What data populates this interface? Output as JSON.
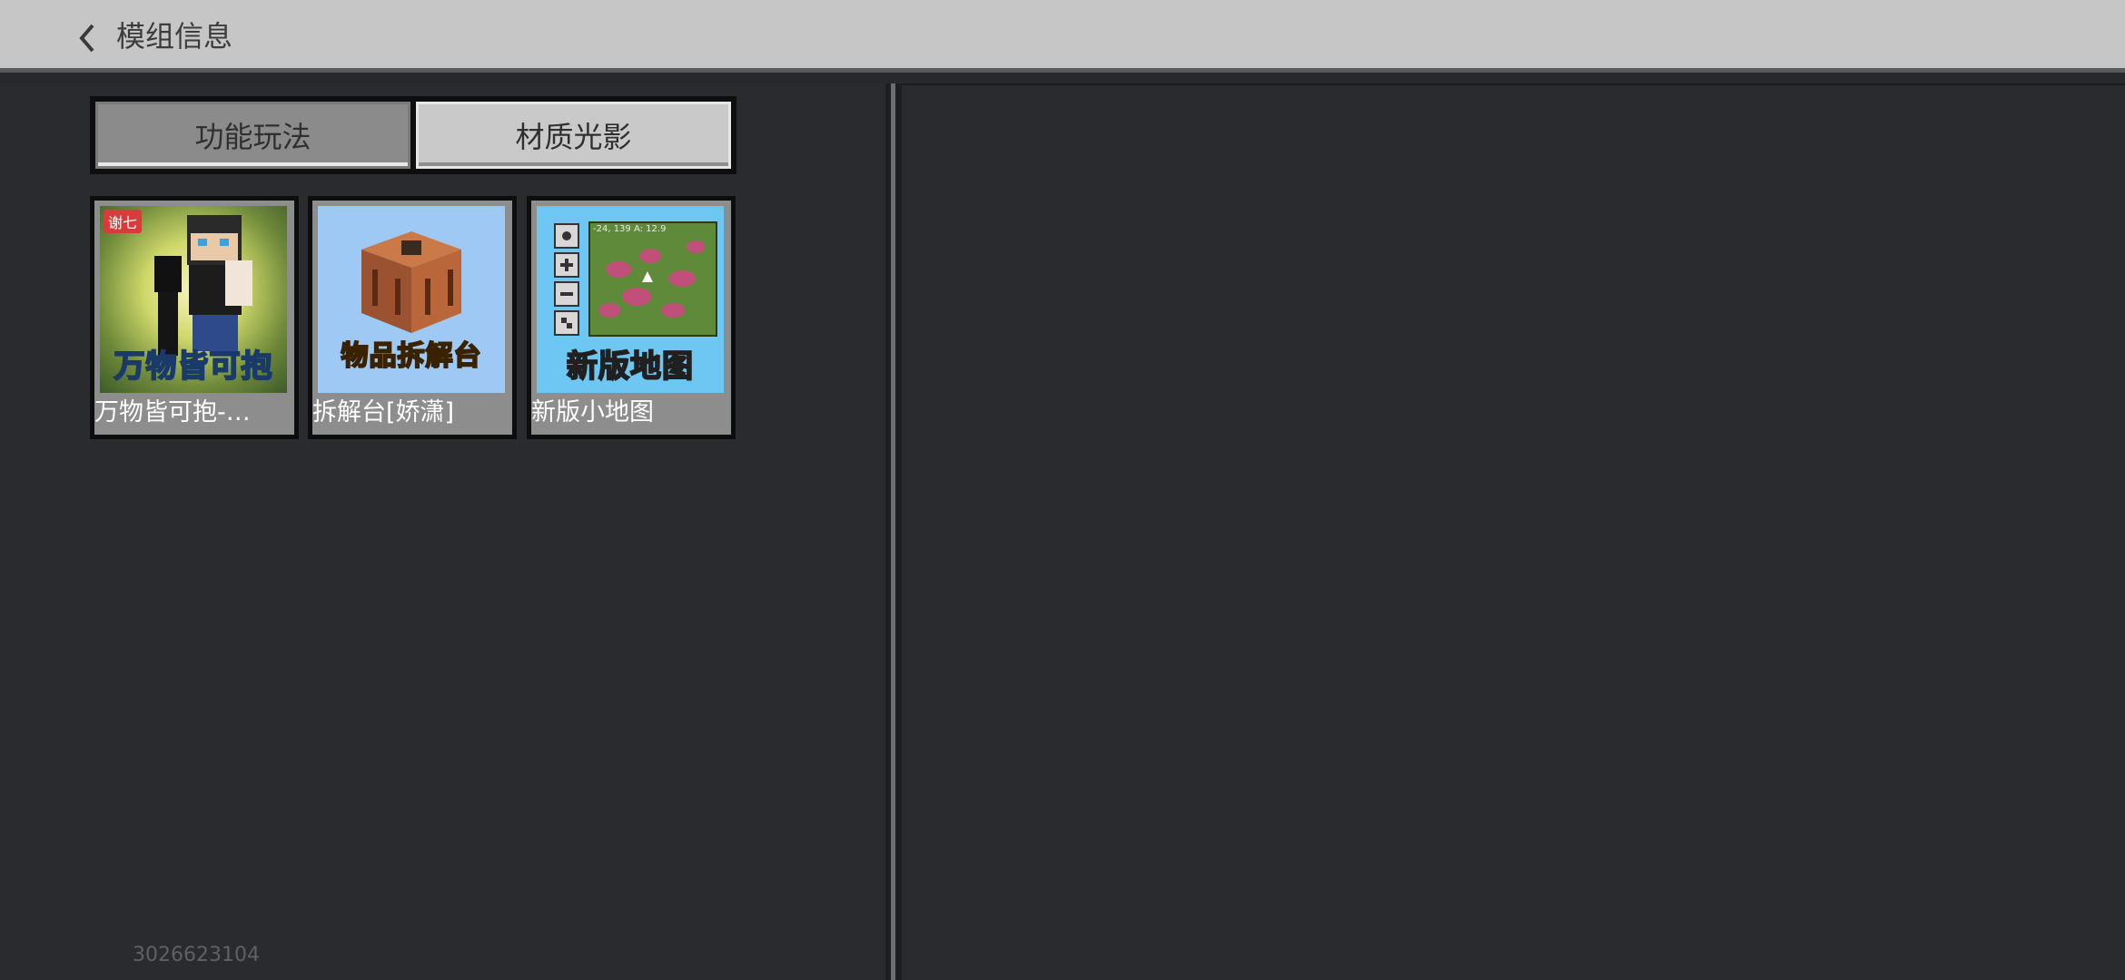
{
  "header": {
    "title": "模组信息",
    "back_icon": "chevron-left-icon"
  },
  "tabs": [
    {
      "label": "功能玩法",
      "active": true
    },
    {
      "label": "材质光影",
      "active": false
    }
  ],
  "mods": [
    {
      "name": "万物皆可抱-…",
      "thumb_text": "万物皆可抱",
      "badge": "谢七"
    },
    {
      "name": "拆解台[娇潇]",
      "thumb_text": "物品拆解台"
    },
    {
      "name": "新版小地图",
      "thumb_text": "新版地图",
      "coords": "-24, 139 A: 12.9"
    }
  ],
  "footer": {
    "id": "3026623104"
  },
  "colors": {
    "topbar": "#c6c6c6",
    "background": "#28292c",
    "card_border": "#8d8d8d"
  }
}
